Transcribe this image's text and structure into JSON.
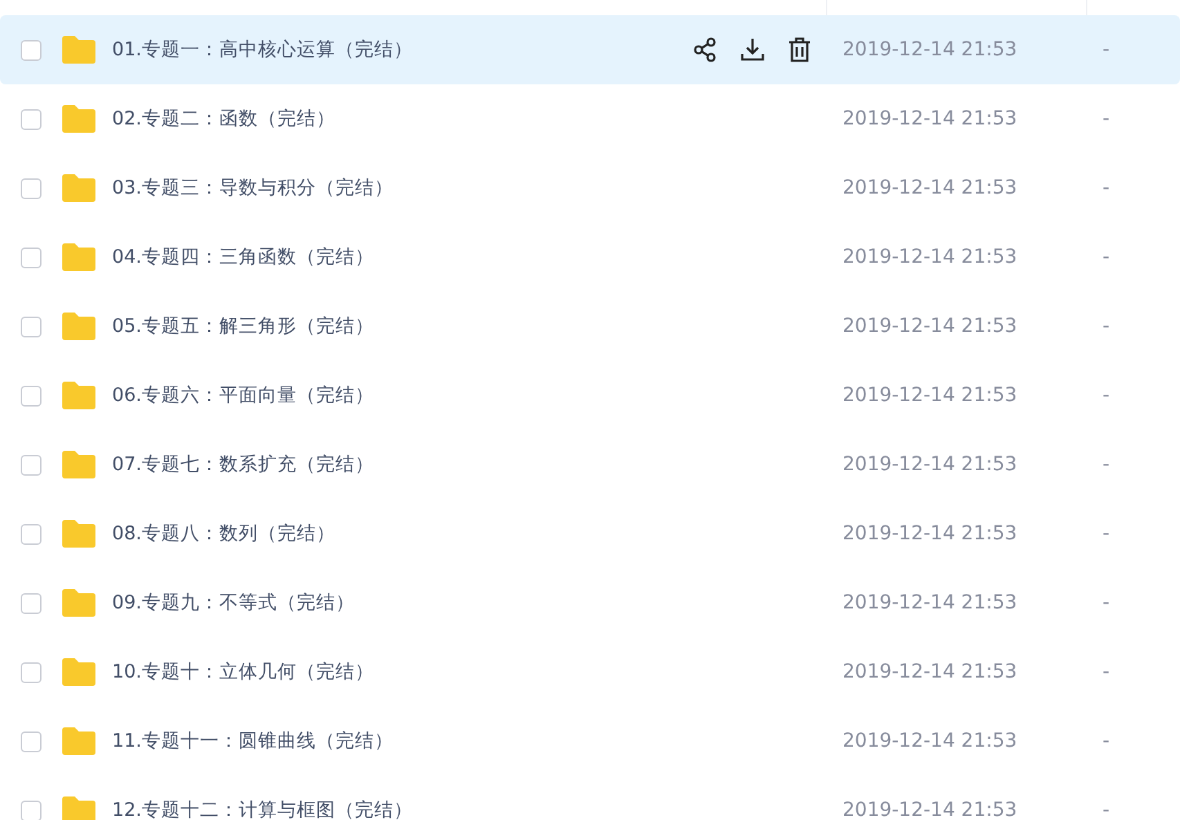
{
  "rows": [
    {
      "name": "01.专题一：高中核心运算（完结）",
      "date": "2019-12-14 21:53",
      "size": "-",
      "checked": false,
      "highlighted": true
    },
    {
      "name": "02.专题二：函数（完结）",
      "date": "2019-12-14 21:53",
      "size": "-",
      "checked": false,
      "highlighted": false
    },
    {
      "name": "03.专题三：导数与积分（完结）",
      "date": "2019-12-14 21:53",
      "size": "-",
      "checked": false,
      "highlighted": false
    },
    {
      "name": "04.专题四：三角函数（完结）",
      "date": "2019-12-14 21:53",
      "size": "-",
      "checked": false,
      "highlighted": false
    },
    {
      "name": "05.专题五：解三角形（完结）",
      "date": "2019-12-14 21:53",
      "size": "-",
      "checked": false,
      "highlighted": false
    },
    {
      "name": "06.专题六：平面向量（完结）",
      "date": "2019-12-14 21:53",
      "size": "-",
      "checked": false,
      "highlighted": false
    },
    {
      "name": "07.专题七：数系扩充（完结）",
      "date": "2019-12-14 21:53",
      "size": "-",
      "checked": false,
      "highlighted": false
    },
    {
      "name": "08.专题八：数列（完结）",
      "date": "2019-12-14 21:53",
      "size": "-",
      "checked": false,
      "highlighted": false
    },
    {
      "name": "09.专题九：不等式（完结）",
      "date": "2019-12-14 21:53",
      "size": "-",
      "checked": false,
      "highlighted": false
    },
    {
      "name": "10.专题十：立体几何（完结）",
      "date": "2019-12-14 21:53",
      "size": "-",
      "checked": false,
      "highlighted": false
    },
    {
      "name": "11.专题十一：圆锥曲线（完结）",
      "date": "2019-12-14 21:53",
      "size": "-",
      "checked": false,
      "highlighted": false
    },
    {
      "name": "12.专题十二：计算与框图（完结）",
      "date": "2019-12-14 21:53",
      "size": "-",
      "checked": false,
      "highlighted": false
    }
  ]
}
